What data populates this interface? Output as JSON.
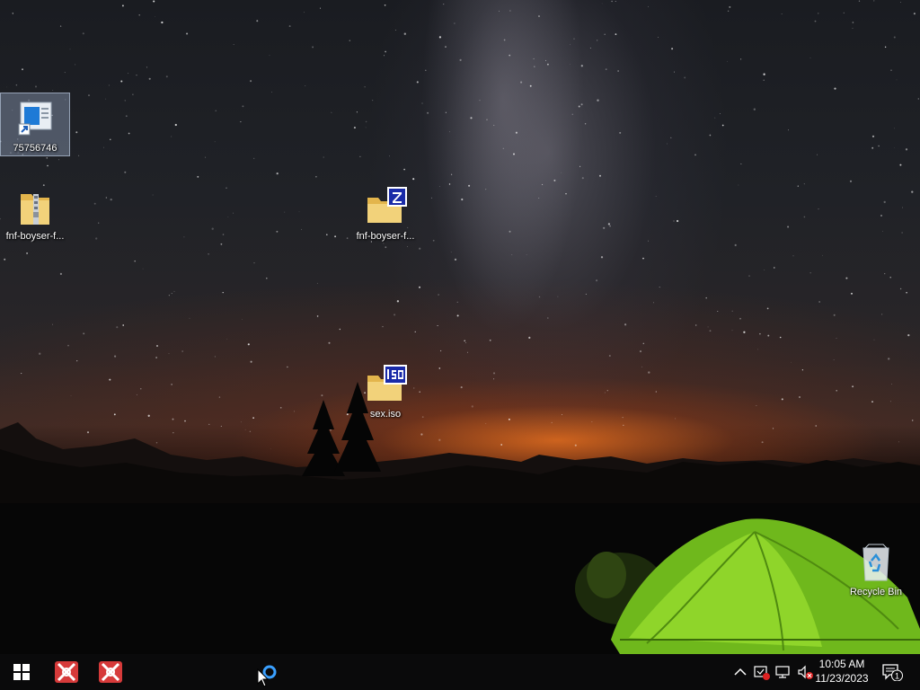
{
  "desktop": {
    "icons": [
      {
        "label": "75756746",
        "icon": "app-shortcut-icon",
        "selected": true
      },
      {
        "label": "fnf-boyser-f...",
        "icon": "zip-folder-icon"
      },
      {
        "label": "fnf-boyser-f...",
        "icon": "winzip-archive-icon"
      },
      {
        "label": "sex.iso",
        "icon": "iso-file-icon"
      },
      {
        "label": "Recycle Bin",
        "icon": "recycle-bin-icon"
      }
    ]
  },
  "taskbar": {
    "start": {
      "icon": "windows-logo-icon"
    },
    "pinned": [
      {
        "icon": "app-red-x-icon"
      },
      {
        "icon": "app-red-x-icon"
      }
    ],
    "search": {
      "icon": "cortana-circle-icon"
    },
    "tray": {
      "icons": [
        "chevron-up-icon",
        "security-alert-icon",
        "network-icon",
        "volume-muted-icon"
      ],
      "time": "10:05 AM",
      "date": "11/23/2023",
      "notification_count": "1"
    }
  },
  "colors": {
    "taskbar_bg": "#0a0a0b",
    "app_red": "#d63a3a",
    "archive_badge": "#1a2ba8",
    "folder_yellow": "#f2d27a"
  }
}
